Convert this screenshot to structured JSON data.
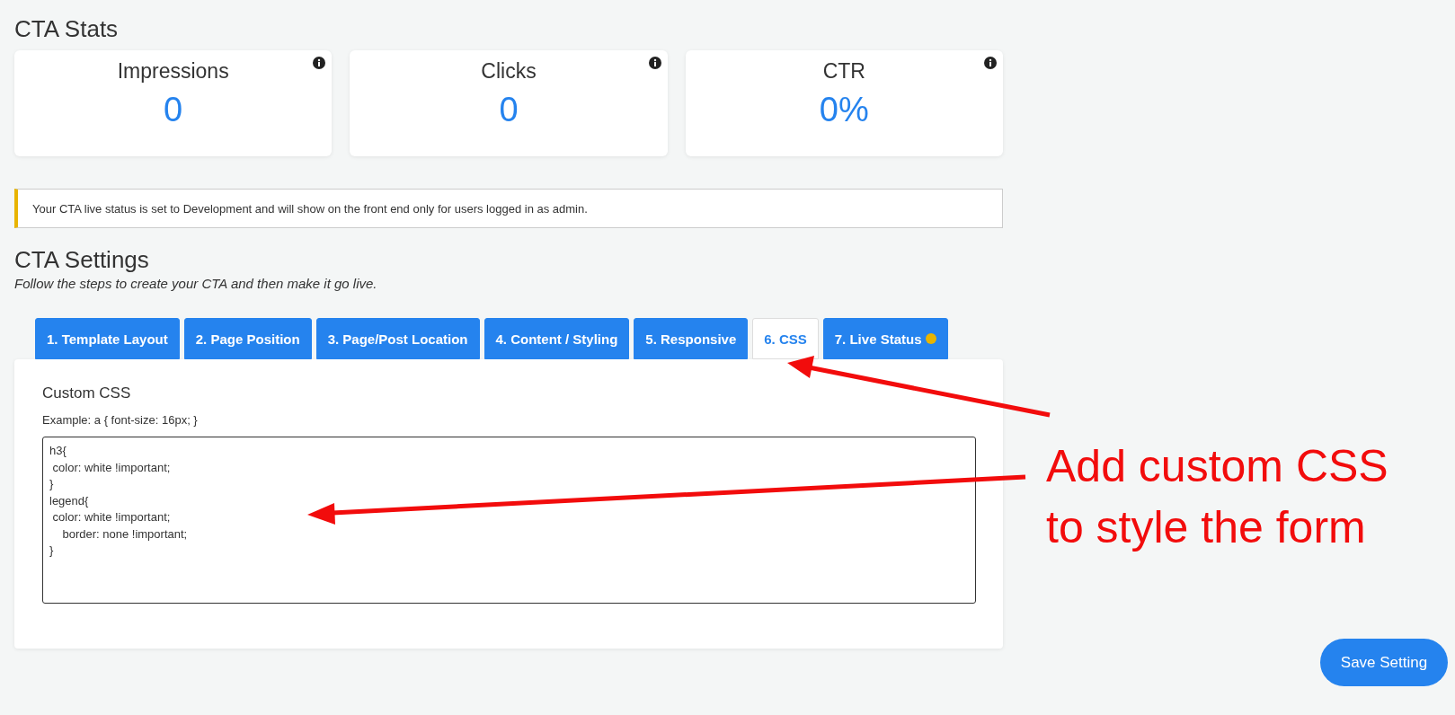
{
  "stats": {
    "title": "CTA Stats",
    "cards": [
      {
        "label": "Impressions",
        "value": "0"
      },
      {
        "label": "Clicks",
        "value": "0"
      },
      {
        "label": "CTR",
        "value": "0%"
      }
    ]
  },
  "notice": {
    "kind": "warning",
    "text": "Your CTA live status is set to Development and will show on the front end only for users logged in as admin."
  },
  "settings": {
    "title": "CTA Settings",
    "subtitle": "Follow the steps to create your CTA and then make it go live.",
    "tabs": [
      {
        "label": "1. Template Layout",
        "selected": false,
        "dot": false
      },
      {
        "label": "2. Page Position",
        "selected": false,
        "dot": false
      },
      {
        "label": "3. Page/Post Location",
        "selected": false,
        "dot": false
      },
      {
        "label": "4. Content / Styling",
        "selected": false,
        "dot": false
      },
      {
        "label": "5. Responsive",
        "selected": false,
        "dot": false
      },
      {
        "label": "6. CSS",
        "selected": true,
        "dot": false
      },
      {
        "label": "7. Live Status",
        "selected": false,
        "dot": true
      }
    ],
    "panel": {
      "heading": "Custom CSS",
      "hint": "Example: a { font-size: 16px; }",
      "code": "h3{\n color: white !important;\n}\nlegend{\n color: white !important;\n    border: none !important;\n}"
    }
  },
  "save_button": "Save Setting",
  "annotation": [
    "Add custom CSS",
    "to style the form"
  ]
}
